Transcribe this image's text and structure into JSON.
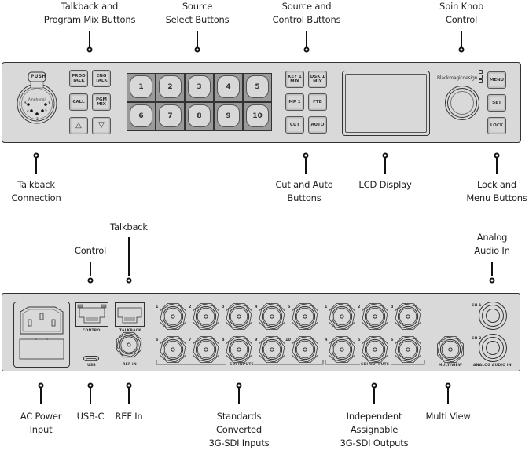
{
  "front_panel": {
    "callouts_top": [
      {
        "lines": [
          "Talkback and",
          "Program Mix Buttons"
        ]
      },
      {
        "lines": [
          "Source",
          "Select Buttons"
        ]
      },
      {
        "lines": [
          "Source and",
          "Control  Buttons"
        ]
      },
      {
        "lines": [
          "Spin Knob",
          "Control"
        ]
      }
    ],
    "callouts_bottom": [
      {
        "lines": [
          "Talkback",
          "Connection"
        ]
      },
      {
        "lines": [
          "Cut and Auto",
          "Buttons"
        ]
      },
      {
        "lines": [
          "LCD Display"
        ]
      },
      {
        "lines": [
          "Lock and",
          "Menu Buttons"
        ]
      }
    ],
    "xlr": {
      "push_label": "PUSH",
      "brand": "Amphenol",
      "pins": [
        "1",
        "2",
        "3",
        "4",
        "5"
      ]
    },
    "talkback_buttons": [
      [
        "PROD",
        "TALK"
      ],
      [
        "ENG",
        "TALK"
      ],
      [
        "CALL"
      ],
      [
        "PGM",
        "MIX"
      ],
      [
        "△"
      ],
      [
        "▽"
      ]
    ],
    "source_buttons": [
      "1",
      "2",
      "3",
      "4",
      "5",
      "6",
      "7",
      "8",
      "9",
      "10"
    ],
    "control_buttons": [
      [
        "KEY 1",
        "MIX"
      ],
      [
        "DSK 1",
        "MIX"
      ],
      [
        "MP 1"
      ],
      [
        "FTB"
      ],
      [
        "CUT"
      ],
      [
        "AUTO"
      ]
    ],
    "brand": "Blackmagicdesign",
    "menu_buttons": [
      "MENU",
      "SET",
      "LOCK"
    ]
  },
  "rear_panel": {
    "callouts_top": [
      {
        "lines": [
          "Talkback"
        ]
      },
      {
        "lines": [
          "Control"
        ]
      },
      {
        "lines": [
          "Analog",
          "Audio In"
        ]
      }
    ],
    "callouts_bottom": [
      {
        "lines": [
          "AC Power",
          "Input"
        ]
      },
      {
        "lines": [
          "USB-C"
        ]
      },
      {
        "lines": [
          "REF In"
        ]
      },
      {
        "lines": [
          "Standards",
          "Converted",
          "3G-SDI Inputs"
        ]
      },
      {
        "lines": [
          "Independent",
          "Assignable",
          "3G-SDI Outputs"
        ]
      },
      {
        "lines": [
          "Multi View"
        ]
      }
    ],
    "labels": {
      "control": "CONTROL",
      "talkback": "TALKBACK",
      "usb": "USB",
      "ref_in": "REF IN",
      "sdi_inputs": "SDI INPUTS",
      "sdi_outputs": "SDI OUTPUTS",
      "multiview": "MULTIVIEW",
      "analog_audio_in": "ANALOG AUDIO IN",
      "ch1": "CH 1",
      "ch2": "CH 2"
    },
    "sdi_input_numbers": [
      "1",
      "2",
      "3",
      "4",
      "5",
      "6",
      "7",
      "8",
      "9",
      "10"
    ],
    "sdi_output_numbers": [
      "1",
      "2",
      "3",
      "4",
      "5",
      "6"
    ]
  }
}
